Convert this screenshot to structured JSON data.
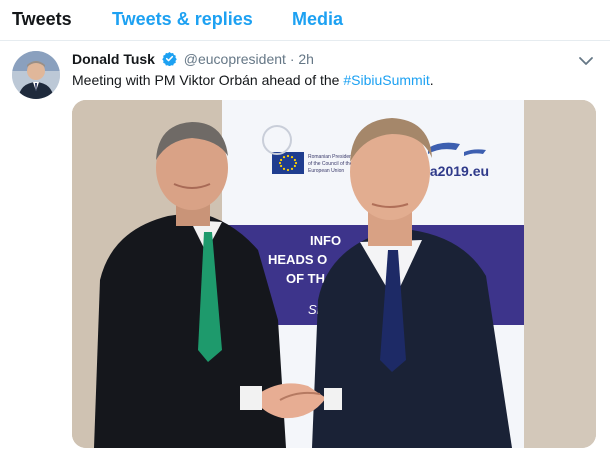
{
  "tabs": [
    {
      "label": "Tweets",
      "active": true
    },
    {
      "label": "Tweets & replies",
      "active": false
    },
    {
      "label": "Media",
      "active": false
    }
  ],
  "tweet": {
    "author_name": "Donald Tusk",
    "author_handle": "@eucopresident",
    "separator": "·",
    "time": "2h",
    "text_prefix": "Meeting with PM Viktor Orbán ahead of the ",
    "hashtag": "#SibiuSummit",
    "text_suffix": ".",
    "verified_icon": "verified-badge-icon",
    "menu_icon": "chevron-down-icon"
  },
  "photo": {
    "banner_line1": "Romanian Presidency",
    "banner_line2": "of the Council of the",
    "banner_line3": "European Union",
    "banner_site": "ia2019.eu",
    "panel_line1": "INFO",
    "panel_line2": "HEADS O",
    "panel_line3": "OF TH",
    "panel_line4": "Si",
    "footer_letter": "a"
  },
  "colors": {
    "accent": "#1da1f2",
    "text_primary": "#14171a",
    "text_secondary": "#657786",
    "eu_blue": "#1f3d8f",
    "banner_purple": "#3d348b"
  }
}
